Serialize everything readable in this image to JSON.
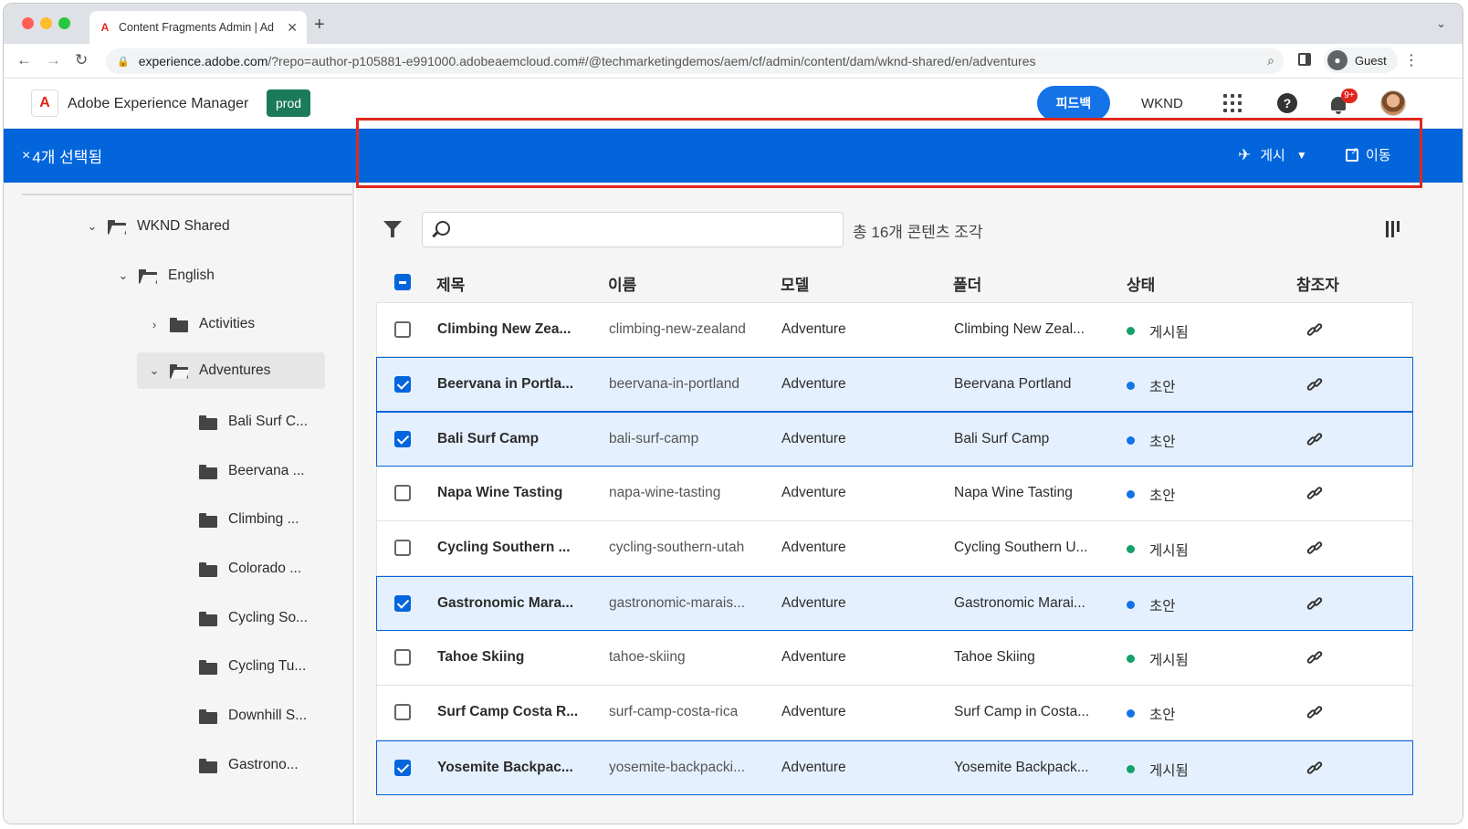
{
  "browser": {
    "tab_title": "Content Fragments Admin | Ad",
    "url_host": "experience.adobe.com",
    "url_rest": "/?repo=author-p105881-e991000.adobeaemcloud.com#/@techmarketingdemos/aem/cf/admin/content/dam/wknd-shared/en/adventures",
    "profile_label": "Guest"
  },
  "header": {
    "product_name": "Adobe Experience Manager",
    "env_badge": "prod",
    "feedback_label": "피드백",
    "org_name": "WKND",
    "notification_count": "9+"
  },
  "selection_bar": {
    "selected_label": "4개 선택됨",
    "publish_label": "게시",
    "move_label": "이동"
  },
  "sidebar": {
    "items": [
      {
        "label": "WKND Shared"
      },
      {
        "label": "English"
      },
      {
        "label": "Activities"
      },
      {
        "label": "Adventures"
      },
      {
        "label": "Bali Surf C..."
      },
      {
        "label": "Beervana ..."
      },
      {
        "label": "Climbing ..."
      },
      {
        "label": "Colorado ..."
      },
      {
        "label": "Cycling So..."
      },
      {
        "label": "Cycling Tu..."
      },
      {
        "label": "Downhill S..."
      },
      {
        "label": "Gastrono..."
      }
    ]
  },
  "main": {
    "search_placeholder": "",
    "total_count": "총 16개 콘텐츠 조각",
    "columns": {
      "title": "제목",
      "name": "이름",
      "model": "모델",
      "folder": "폴더",
      "status": "상태",
      "references": "참조자"
    },
    "rows": [
      {
        "title": "Climbing New Zea...",
        "name": "climbing-new-zealand",
        "model": "Adventure",
        "folder": "Climbing New Zeal...",
        "status": "게시됨",
        "status_color": "#12a26c",
        "selected": false
      },
      {
        "title": "Beervana in Portla...",
        "name": "beervana-in-portland",
        "model": "Adventure",
        "folder": "Beervana Portland",
        "status": "초안",
        "status_color": "#1473e6",
        "selected": true
      },
      {
        "title": "Bali Surf Camp",
        "name": "bali-surf-camp",
        "model": "Adventure",
        "folder": "Bali Surf Camp",
        "status": "초안",
        "status_color": "#1473e6",
        "selected": true
      },
      {
        "title": "Napa Wine Tasting",
        "name": "napa-wine-tasting",
        "model": "Adventure",
        "folder": "Napa Wine Tasting",
        "status": "초안",
        "status_color": "#1473e6",
        "selected": false
      },
      {
        "title": "Cycling Southern ...",
        "name": "cycling-southern-utah",
        "model": "Adventure",
        "folder": "Cycling Southern U...",
        "status": "게시됨",
        "status_color": "#12a26c",
        "selected": false
      },
      {
        "title": "Gastronomic Mara...",
        "name": "gastronomic-marais...",
        "model": "Adventure",
        "folder": "Gastronomic Marai...",
        "status": "초안",
        "status_color": "#1473e6",
        "selected": true
      },
      {
        "title": "Tahoe Skiing",
        "name": "tahoe-skiing",
        "model": "Adventure",
        "folder": "Tahoe Skiing",
        "status": "게시됨",
        "status_color": "#12a26c",
        "selected": false
      },
      {
        "title": "Surf Camp Costa R...",
        "name": "surf-camp-costa-rica",
        "model": "Adventure",
        "folder": "Surf Camp in Costa...",
        "status": "초안",
        "status_color": "#1473e6",
        "selected": false
      },
      {
        "title": "Yosemite Backpac...",
        "name": "yosemite-backpacki...",
        "model": "Adventure",
        "folder": "Yosemite Backpack...",
        "status": "게시됨",
        "status_color": "#12a26c",
        "selected": true
      }
    ]
  },
  "colors": {
    "accent": "#0265dc",
    "highlight_border": "#e0281d",
    "prod_badge": "#1b7a5a"
  }
}
